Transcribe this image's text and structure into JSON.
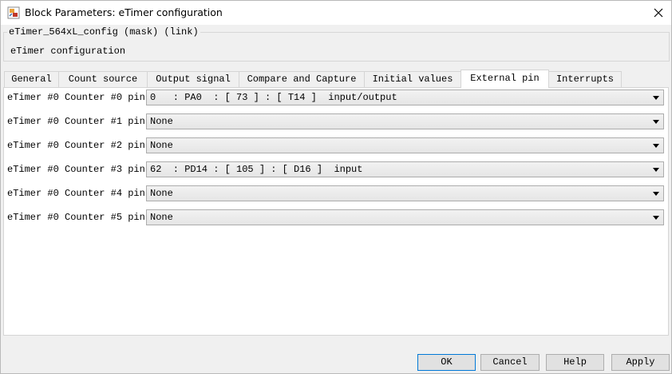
{
  "window": {
    "title": "Block Parameters: eTimer configuration",
    "icon": "simulink-block-icon"
  },
  "mask": {
    "legend": "eTimer_564xL_config (mask) (link)",
    "description": "eTimer configuration"
  },
  "tabs": [
    {
      "label": "General"
    },
    {
      "label": "Count source"
    },
    {
      "label": "Output signal"
    },
    {
      "label": "Compare and Capture"
    },
    {
      "label": "Initial values"
    },
    {
      "label": "External pin"
    },
    {
      "label": "Interrupts"
    }
  ],
  "active_tab": "External pin",
  "rows": [
    {
      "label": "eTimer #0 Counter #0 pin",
      "value": "0   : PA0  : [ 73 ] : [ T14 ]  input/output"
    },
    {
      "label": "eTimer #0 Counter #1 pin",
      "value": "None"
    },
    {
      "label": "eTimer #0 Counter #2 pin",
      "value": "None"
    },
    {
      "label": "eTimer #0 Counter #3 pin",
      "value": "62  : PD14 : [ 105 ] : [ D16 ]  input"
    },
    {
      "label": "eTimer #0 Counter #4 pin",
      "value": "None"
    },
    {
      "label": "eTimer #0 Counter #5 pin",
      "value": "None"
    }
  ],
  "buttons": {
    "ok": "OK",
    "cancel": "Cancel",
    "help": "Help",
    "apply": "Apply"
  },
  "colors": {
    "default_button_border": "#0078d7"
  }
}
